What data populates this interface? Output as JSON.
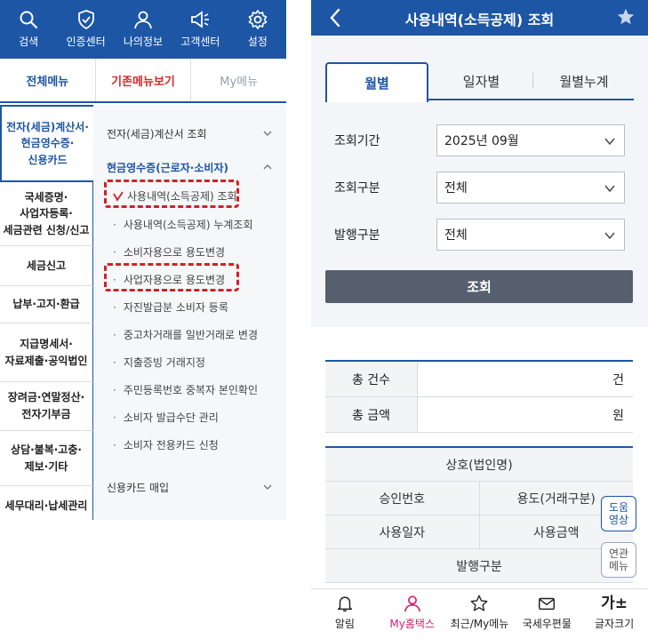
{
  "left": {
    "top_icons": [
      {
        "icon": "search-icon",
        "label": "검색"
      },
      {
        "icon": "shield-icon",
        "label": "인증센터"
      },
      {
        "icon": "person-icon",
        "label": "나의정보"
      },
      {
        "icon": "megaphone-icon",
        "label": "고객센터"
      },
      {
        "icon": "gear-icon",
        "label": "설정"
      }
    ],
    "tabs": [
      "전체메뉴",
      "기존메뉴보기",
      "My메뉴"
    ],
    "categories": [
      [
        "전자(세금)계산서·",
        "현금영수증·",
        "신용카드"
      ],
      [
        "국세증명·",
        "사업자등록·",
        "세금관련 신청/신고"
      ],
      [
        "세금신고"
      ],
      [
        "납부·고지·환급"
      ],
      [
        "지급명세서·",
        "자료제출·공익법인"
      ],
      [
        "장려금·연말정산·",
        "전자기부금"
      ],
      [
        "상담·불복·고충·",
        "제보·기타"
      ],
      [
        "세무대리·납세관리"
      ]
    ],
    "submenu": {
      "header1": "전자(세금)계산서 조회",
      "header2": "현금영수증(근로자·소비자)",
      "items": [
        "사용내역(소득공제) 조회",
        "사용내역(소득공제) 누계조회",
        "소비자용으로 용도변경",
        "사업자용으로 용도변경",
        "자진발급분 소비자 등록",
        "중고차거래를 일반거래로 변경",
        "지출증빙 거래지정",
        "주민등록번호 중복자 본인확인",
        "소비자 발급수단 관리",
        "소비자 전용카드 신청"
      ],
      "header3": "신용카드 매입"
    },
    "colors": {
      "brand": "#1d56a5",
      "highlight": "#d21f2a"
    }
  },
  "right": {
    "title": "사용내역(소득공제) 조회",
    "tabs": [
      "월별",
      "일자별",
      "월별누계"
    ],
    "fields": [
      {
        "label": "조회기간",
        "value": "2025년 09월"
      },
      {
        "label": "조회구분",
        "value": "전체"
      },
      {
        "label": "발행구분",
        "value": "전체"
      }
    ],
    "search_button": "조회",
    "summary": [
      {
        "label": "총 건수",
        "unit": "건"
      },
      {
        "label": "총 금액",
        "unit": "원"
      }
    ],
    "result_headers": {
      "row1": "상호(법인명)",
      "row2": [
        "승인번호",
        "용도(거래구분)"
      ],
      "row3": [
        "사용일자",
        "사용금액"
      ],
      "row4": "발행구분"
    },
    "float_buttons": [
      [
        "도움",
        "영상"
      ],
      [
        "연관",
        "메뉴"
      ]
    ],
    "bottom_nav": [
      {
        "icon": "bell-icon",
        "label": "알림"
      },
      {
        "icon": "person-icon",
        "label": "My홈택스"
      },
      {
        "icon": "star-outline-icon",
        "label": "최근/My메뉴"
      },
      {
        "icon": "mail-icon",
        "label": "국세우편물"
      },
      {
        "icon": "font-size-icon",
        "glyph": "가±",
        "label": "글자크기"
      }
    ]
  }
}
